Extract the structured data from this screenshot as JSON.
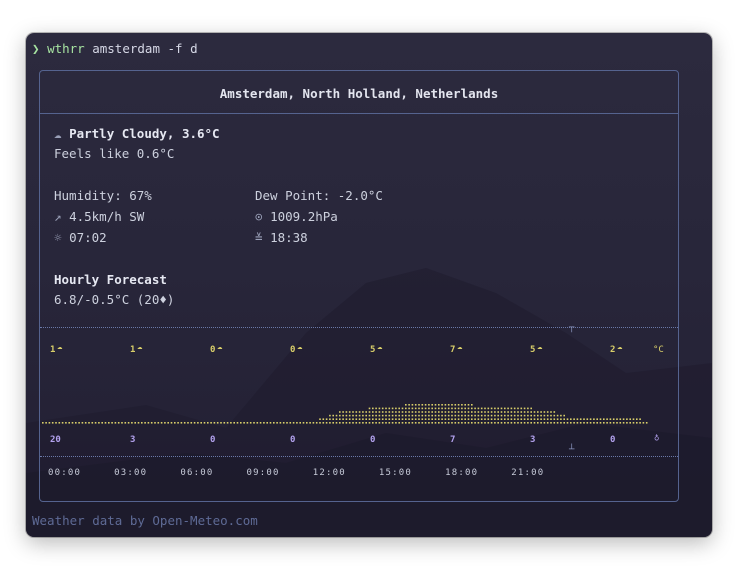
{
  "terminal": {
    "prompt_symbol": "❯",
    "command": "wthrr",
    "args": "amsterdam -f d"
  },
  "location": "Amsterdam, North Holland, Netherlands",
  "current": {
    "condition_icon": "☁",
    "condition": "Partly Cloudy, 3.6°C",
    "feels_like": "Feels like 0.6°C",
    "humidity": "Humidity: 67%",
    "dew_point": "Dew Point: -2.0°C",
    "wind_icon": "↗",
    "wind": "4.5km/h SW",
    "pressure_icon": "⊙",
    "pressure": "1009.2hPa",
    "sunrise_icon": "☼",
    "sunrise": "07:02",
    "sunset_icon": "≚",
    "sunset": "18:38"
  },
  "hourly": {
    "title": "Hourly Forecast",
    "summary": "6.8/-0.5°C (20",
    "summary_icon": "♦",
    "summary_end": ")",
    "unit": "°C",
    "precip_icon": "♁",
    "times": "00:00     03:00     06:00     09:00     12:00     15:00     18:00     21:00"
  },
  "chart_data": {
    "type": "bar",
    "categories": [
      "00:00",
      "03:00",
      "06:00",
      "09:00",
      "12:00",
      "15:00",
      "18:00",
      "21:00"
    ],
    "temperature_labels": [
      "1",
      "1",
      "0",
      "0",
      "5",
      "7",
      "5",
      "2"
    ],
    "precipitation_labels": [
      "20",
      "3",
      "0",
      "0",
      "0",
      "7",
      "3",
      "0"
    ],
    "temperature_profile": [
      1,
      1,
      1,
      1,
      1,
      1,
      1,
      1,
      1,
      1,
      1,
      1,
      1,
      1,
      1,
      1,
      1,
      1,
      1,
      1,
      1,
      1,
      1,
      1,
      1,
      1,
      1,
      1,
      1,
      1,
      1,
      1,
      1,
      1,
      1,
      1,
      1,
      1,
      1,
      1,
      1,
      1,
      1,
      1,
      1,
      1,
      1,
      1,
      1,
      1,
      1,
      1,
      1,
      1,
      1,
      1,
      1,
      1,
      1,
      1,
      1,
      1,
      1,
      1,
      1,
      1,
      1,
      1,
      1,
      1,
      1,
      1,
      1,
      1,
      1,
      1,
      1,
      1,
      1,
      1,
      1,
      1,
      1,
      1,
      2,
      2,
      2,
      3,
      3,
      3,
      4,
      4,
      4,
      4,
      4,
      4,
      4,
      4,
      4,
      5,
      5,
      5,
      5,
      5,
      5,
      5,
      5,
      5,
      5,
      5,
      6,
      6,
      6,
      6,
      6,
      6,
      6,
      6,
      6,
      6,
      6,
      6,
      6,
      6,
      6,
      6,
      6,
      6,
      6,
      6,
      6,
      5,
      5,
      5,
      5,
      5,
      5,
      5,
      5,
      5,
      5,
      5,
      5,
      5,
      5,
      5,
      5,
      5,
      5,
      4,
      4,
      4,
      4,
      4,
      4,
      4,
      3,
      3,
      3,
      2,
      2,
      2,
      2,
      2,
      2,
      2,
      2,
      2,
      2,
      2,
      2,
      2,
      2,
      2,
      2,
      2,
      2,
      2,
      2,
      2,
      2,
      2,
      1,
      1
    ]
  },
  "footer": {
    "credit": "Weather data by Open-Meteo.com"
  },
  "colors": {
    "accent_green": "#a6e3a1",
    "chart_yellow": "#d9cf6a",
    "precip_purple": "#b3a2ee",
    "border": "#55638f"
  }
}
